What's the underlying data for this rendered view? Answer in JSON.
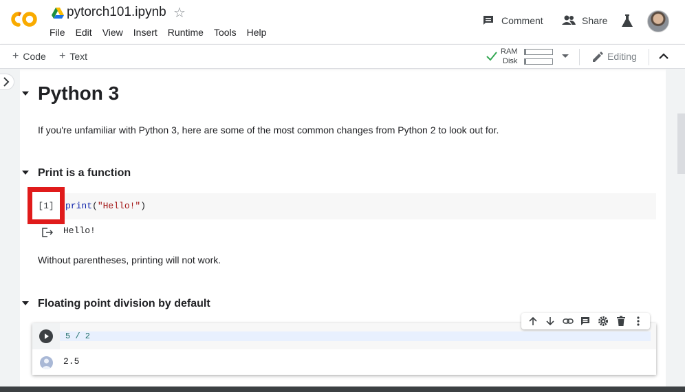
{
  "header": {
    "title": "pytorch101.ipynb",
    "menu": [
      "File",
      "Edit",
      "View",
      "Insert",
      "Runtime",
      "Tools",
      "Help"
    ],
    "comment_label": "Comment",
    "share_label": "Share"
  },
  "toolbar": {
    "add_code_label": "Code",
    "add_text_label": "Text",
    "ram_label": "RAM",
    "disk_label": "Disk",
    "editing_label": "Editing"
  },
  "notebook": {
    "heading_main": "Python 3",
    "intro_text": "If you're unfamiliar with Python 3, here are some of the most common changes from Python 2 to look out for.",
    "section_print": {
      "heading": "Print is a function",
      "execution_count": "[1]",
      "code_func": "print",
      "code_open": "(",
      "code_string": "\"Hello!\"",
      "code_close": ")",
      "output": "Hello!",
      "note": "Without parentheses, printing will not work."
    },
    "section_float": {
      "heading": "Floating point division by default",
      "code": "5 / 2",
      "output": "2.5"
    }
  },
  "colors": {
    "accent_orange": "#f9ab00",
    "highlight_red": "#e01b1b",
    "ok_green": "#34a853"
  }
}
